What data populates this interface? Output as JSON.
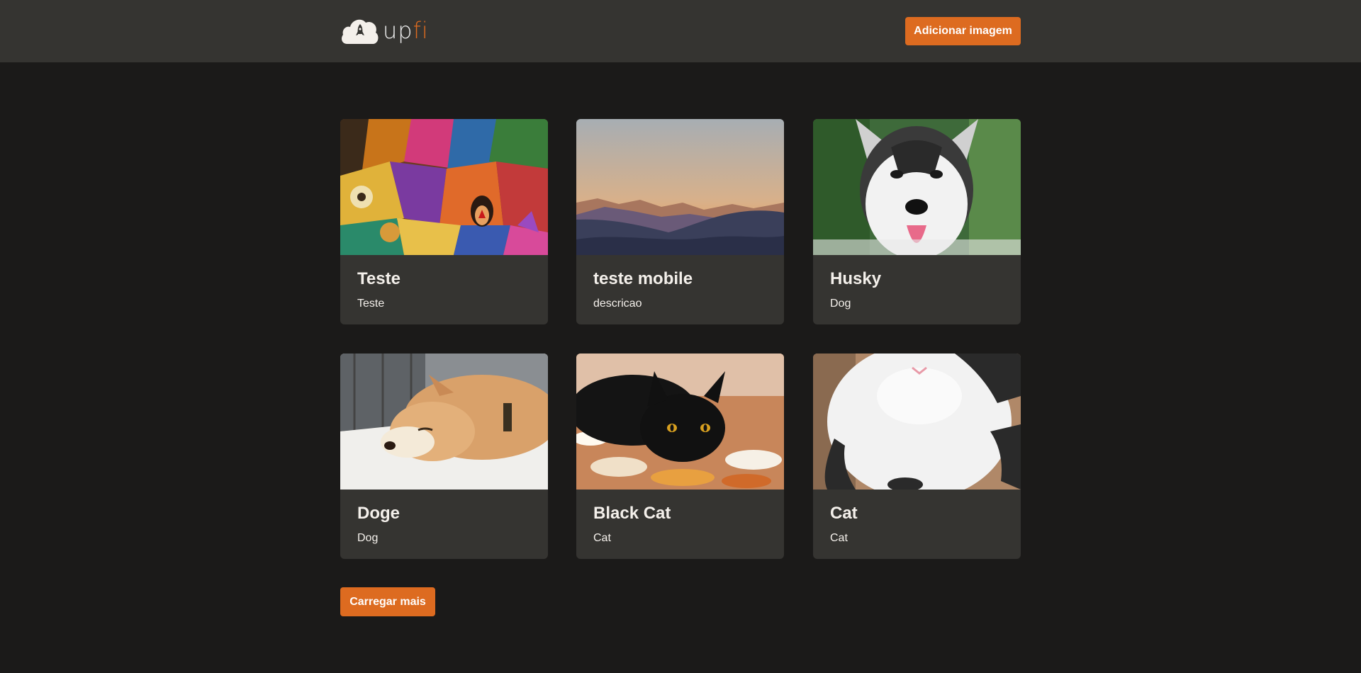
{
  "header": {
    "logo": {
      "text_main": "up",
      "text_accent": "fi",
      "icon": "rocket-cloud-icon"
    },
    "add_image_label": "Adicionar imagem"
  },
  "cards": [
    {
      "title": "Teste",
      "description": "Teste",
      "image": "abstract-cubist-painting"
    },
    {
      "title": "teste mobile",
      "description": "descricao",
      "image": "mountain-sunset"
    },
    {
      "title": "Husky",
      "description": "Dog",
      "image": "husky-dog-photo"
    },
    {
      "title": "Doge",
      "description": "Dog",
      "image": "shiba-inu-sleeping-photo"
    },
    {
      "title": "Black Cat",
      "description": "Cat",
      "image": "black-cat-photo"
    },
    {
      "title": "Cat",
      "description": "Cat",
      "image": "white-cat-photo"
    }
  ],
  "load_more_label": "Carregar mais",
  "colors": {
    "accent": "#dd6b20",
    "background": "#1b1a19",
    "surface": "#353431",
    "text": "#f4f0eb"
  }
}
